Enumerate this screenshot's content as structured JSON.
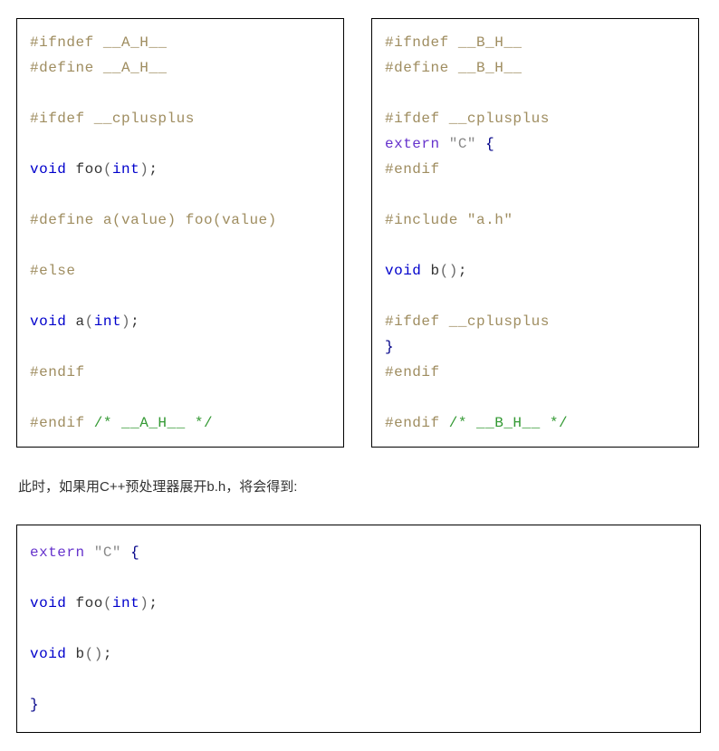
{
  "box_a": {
    "l1": {
      "pp": "#ifndef",
      "rest": " __A_H__"
    },
    "l2": {
      "pp": "#define",
      "rest": " __A_H__"
    },
    "l3": {
      "pp": "#ifdef",
      "rest": " __cplusplus"
    },
    "l4": {
      "kw": "void",
      "sp1": " ",
      "id": "foo",
      "p": "(",
      "kw2": "int",
      "p2": ")",
      "end": ";"
    },
    "l5": {
      "pp": "#define",
      "rest": " a(value) foo(value)"
    },
    "l6": {
      "pp": "#else"
    },
    "l7": {
      "kw": "void",
      "sp1": " ",
      "id": "a",
      "p": "(",
      "kw2": "int",
      "p2": ")",
      "end": ";"
    },
    "l8": {
      "pp": "#endif"
    },
    "l9": {
      "pp": "#endif",
      "sp": " ",
      "c": "/* __A_H__ */"
    }
  },
  "box_b": {
    "l1": {
      "pp": "#ifndef",
      "rest": " __B_H__"
    },
    "l2": {
      "pp": "#define",
      "rest": " __B_H__"
    },
    "l3": {
      "pp": "#ifdef",
      "rest": " __cplusplus"
    },
    "l4": {
      "ext": "extern",
      "sp": " ",
      "str": "\"C\"",
      "sp2": " ",
      "br": "{"
    },
    "l5": {
      "pp": "#endif"
    },
    "l6": {
      "pp": "#include",
      "sp": " ",
      "str": "\"a.h\""
    },
    "l7": {
      "kw": "void",
      "sp1": " ",
      "id": "b",
      "p": "(",
      "p2": ")",
      "end": ";"
    },
    "l8": {
      "pp": "#ifdef",
      "rest": " __cplusplus"
    },
    "l9": {
      "br": "}"
    },
    "l10": {
      "pp": "#endif"
    },
    "l11": {
      "pp": "#endif",
      "sp": " ",
      "c": "/* __B_H__ */"
    }
  },
  "explain_text": "此时，如果用C++预处理器展开b.h，将会得到:",
  "box_c": {
    "l1": {
      "ext": "extern",
      "sp": " ",
      "str": "\"C\"",
      "sp2": " ",
      "br": "{"
    },
    "l2": {
      "kw": "void",
      "sp1": " ",
      "id": "foo",
      "p": "(",
      "kw2": "int",
      "p2": ")",
      "end": ";"
    },
    "l3": {
      "kw": "void",
      "sp1": " ",
      "id": "b",
      "p": "(",
      "p2": ")",
      "end": ";"
    },
    "l4": {
      "br": "}"
    }
  }
}
